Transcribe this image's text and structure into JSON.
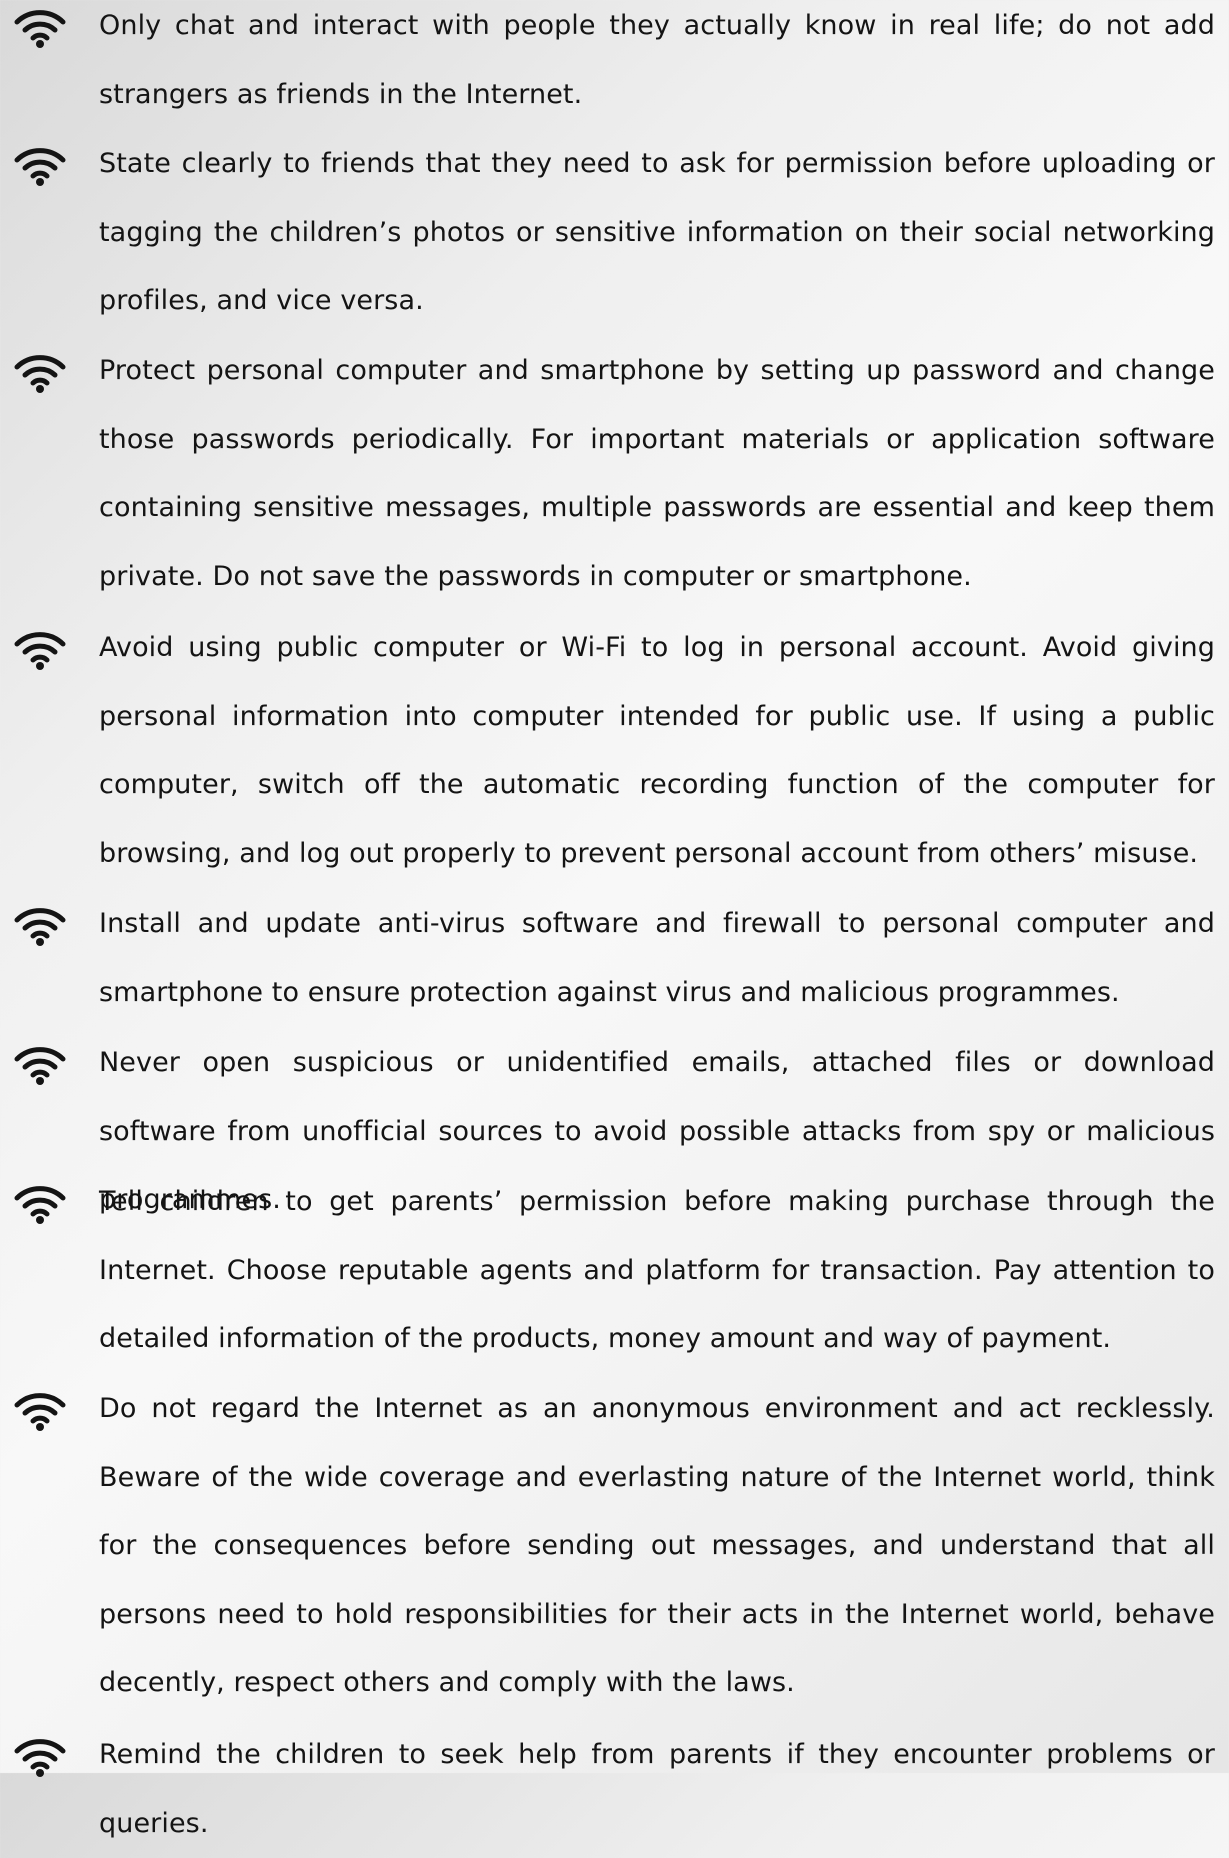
{
  "icon": "wifi-icon",
  "tips": [
    "Only chat and interact with people they actually know in real life; do not add strangers as friends in the Internet.",
    "State clearly to friends that they need to ask for permission before uploading or tagging the children’s photos or sensitive information on their social networking profiles, and vice versa.",
    "Protect personal computer and smartphone by setting up password and change those passwords periodically.  For important materials or application software containing sensitive messages, multiple passwords are essential and keep them private.  Do not save the passwords in computer or smartphone.",
    "Avoid using public computer or Wi-Fi to log in personal account.  Avoid giving personal information into computer intended for public use.  If using a public computer, switch off the automatic recording function of the computer for browsing, and log out properly to prevent personal account from others’ misuse.",
    "Install and update anti-virus software and firewall to personal computer and smartphone to ensure protection against virus and malicious programmes.",
    "Never open suspicious or unidentified emails, attached files or download software from unofficial sources to avoid possible attacks from spy or malicious programmes.",
    "Tell children to get parents’ permission before making purchase through the Internet.  Choose reputable agents and platform for transaction.  Pay attention to detailed information of the products, money amount and way of payment.",
    "Do not regard the Internet as an anonymous environment and act recklessly.  Beware of the wide coverage and everlasting nature of the Internet world, think for the consequences before sending out messages, and understand that all persons need to hold responsibilities for their acts in the Internet world, behave decently, respect others and comply with the laws.",
    "Remind the children to seek help from parents if they encounter problems or queries."
  ]
}
